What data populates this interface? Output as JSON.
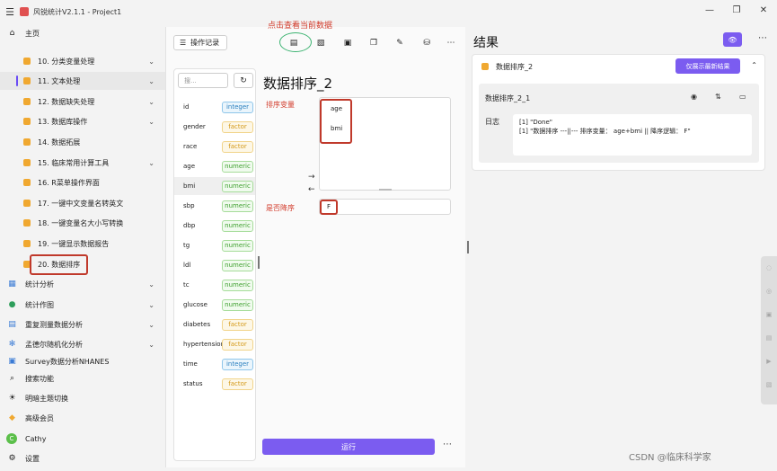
{
  "window": {
    "title": "风锐统计V2.1.1 - Project1",
    "controls": [
      "—",
      "❐",
      "✕"
    ]
  },
  "sidebar": {
    "home": "主页",
    "items": [
      {
        "label": "10. 分类变量处理"
      },
      {
        "label": "11. 文本处理"
      },
      {
        "label": "12. 数据缺失处理"
      },
      {
        "label": "13. 数据库操作"
      },
      {
        "label": "14. 数据拓展"
      },
      {
        "label": "15. 临床常用计算工具"
      },
      {
        "label": "16. R菜单操作界面"
      },
      {
        "label": "17. 一键中文变量名转英文"
      },
      {
        "label": "18. 一键变量名大小写转换"
      },
      {
        "label": "19. 一键显示数据报告"
      },
      {
        "label": "20. 数据排序"
      }
    ],
    "sections": [
      {
        "label": "统计分析"
      },
      {
        "label": "统计作图"
      },
      {
        "label": "重复测量数据分析"
      },
      {
        "label": "孟德尔随机化分析"
      },
      {
        "label": "Survey数据分析NHANES"
      }
    ],
    "bottom": {
      "search": "搜索功能",
      "theme": "明暗主题切换",
      "vip": "高级会员",
      "user": "Cathy",
      "user_initial": "C",
      "settings": "设置"
    }
  },
  "main": {
    "history_button": "操作记录",
    "annotation": "点击查看当前数据",
    "search_placeholder": "搜...",
    "page_title": "数据排序_2",
    "sort_var_label": "排序变量",
    "sort_vars": [
      "age",
      "bmi"
    ],
    "descending_label": "是否降序",
    "descending_value": "F",
    "run_button": "运行",
    "variables": [
      {
        "name": "id",
        "type": "integer"
      },
      {
        "name": "gender",
        "type": "factor"
      },
      {
        "name": "race",
        "type": "factor"
      },
      {
        "name": "age",
        "type": "numeric"
      },
      {
        "name": "bmi",
        "type": "numeric"
      },
      {
        "name": "sbp",
        "type": "numeric"
      },
      {
        "name": "dbp",
        "type": "numeric"
      },
      {
        "name": "tg",
        "type": "numeric"
      },
      {
        "name": "ldl",
        "type": "numeric"
      },
      {
        "name": "tc",
        "type": "numeric"
      },
      {
        "name": "glucose",
        "type": "numeric"
      },
      {
        "name": "diabetes",
        "type": "factor"
      },
      {
        "name": "hypertension",
        "type": "factor"
      },
      {
        "name": "time",
        "type": "integer"
      },
      {
        "name": "status",
        "type": "factor"
      }
    ]
  },
  "results": {
    "title": "结果",
    "card_name": "数据排序_2",
    "latest_button": "仅展示最新结果",
    "inner_name": "数据排序_2_1",
    "log_label": "日志",
    "log_lines": [
      "[1] \"Done\"",
      "[1] \"数据排序 ---||--- 排序变量： age+bmi || 降序逻辑： F\""
    ]
  },
  "watermark": "CSDN @临床科学家",
  "colors": {
    "accent": "#7b5cf0",
    "annotation": "#d23a2a",
    "folder": "#f0a830"
  }
}
